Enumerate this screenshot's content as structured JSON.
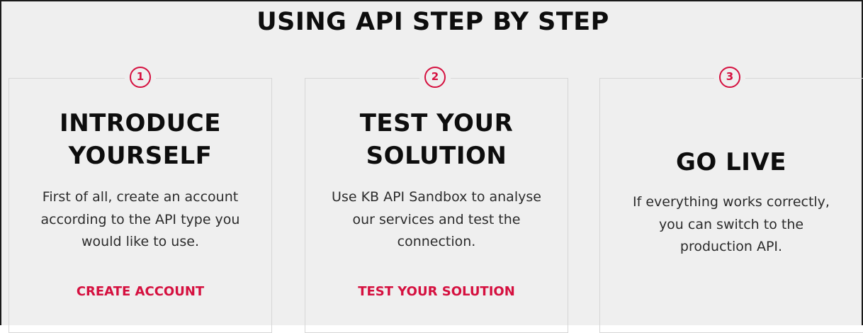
{
  "page": {
    "title": "USING API STEP BY STEP"
  },
  "steps": [
    {
      "number": "1",
      "heading_line1": "INTRODUCE",
      "heading_line2": "YOURSELF",
      "description": "First of all, create an account according to the API type you would like to use.",
      "link": "CREATE ACCOUNT"
    },
    {
      "number": "2",
      "heading_line1": "TEST YOUR",
      "heading_line2": "SOLUTION",
      "description": "Use KB API Sandbox to analyse our services and test the connection.",
      "link": "TEST YOUR SOLUTION"
    },
    {
      "number": "3",
      "heading_line1": "GO LIVE",
      "description": "If everything works correctly, you can switch to the production API."
    }
  ],
  "colors": {
    "accent": "#d5103f",
    "background": "#efefef",
    "heading": "#0d0d0d",
    "body_text": "#2b2b2b",
    "card_border": "#d6d6d6"
  }
}
